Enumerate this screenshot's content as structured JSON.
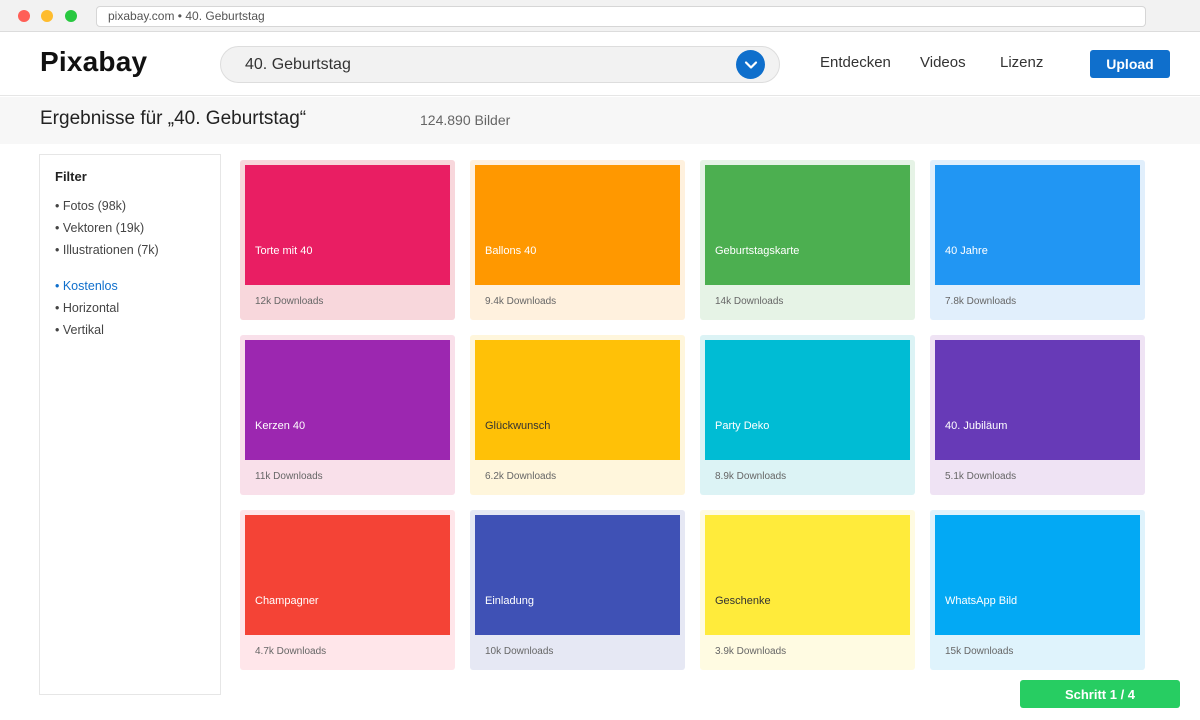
{
  "browser": {
    "address": "pixabay.com • 40. Geburtstag"
  },
  "header": {
    "logo": "Pixabay",
    "search_value": "40. Geburtstag",
    "search_icon": "chevron-down-icon",
    "nav": {
      "discover": "Entdecken",
      "videos": "Videos",
      "license": "Lizenz"
    },
    "upload_label": "Upload",
    "accent_color": "#0f6fcc"
  },
  "results": {
    "title": "Ergebnisse für „40. Geburtstag“",
    "count": "124.890 Bilder"
  },
  "filter": {
    "title": "Filter",
    "items": [
      {
        "label": "• Fotos (98k)",
        "active": false
      },
      {
        "label": "• Vektoren (19k)",
        "active": false
      },
      {
        "label": "• Illustrationen (7k)",
        "active": false
      },
      {
        "label": "• Kostenlos",
        "active": true
      },
      {
        "label": "• Horizontal",
        "active": false
      },
      {
        "label": "• Vertikal",
        "active": false
      }
    ]
  },
  "cards": [
    {
      "label": "Torte mit 40",
      "downloads": "12k Downloads",
      "color": "#e91e63",
      "bg": "#f8d7dc"
    },
    {
      "label": "Ballons 40",
      "downloads": "9.4k Downloads",
      "color": "#ff9800",
      "bg": "#fff1de"
    },
    {
      "label": "Geburtstagskarte",
      "downloads": "14k Downloads",
      "color": "#4caf50",
      "bg": "#e6f3e6"
    },
    {
      "label": "40 Jahre",
      "downloads": "7.8k Downloads",
      "color": "#2196f3",
      "bg": "#e1effc"
    },
    {
      "label": "Kerzen 40",
      "downloads": "11k Downloads",
      "color": "#9c27b0",
      "bg": "#f9e0ea"
    },
    {
      "label": "Glückwunsch",
      "downloads": "6.2k Downloads",
      "color": "#ffc107",
      "bg": "#fff6dc"
    },
    {
      "label": "Party Deko",
      "downloads": "8.9k Downloads",
      "color": "#00bcd4",
      "bg": "#dcf3f5"
    },
    {
      "label": "40. Jubiläum",
      "downloads": "5.1k Downloads",
      "color": "#673ab7",
      "bg": "#efe3f4"
    },
    {
      "label": "Champagner",
      "downloads": "4.7k Downloads",
      "color": "#f44336",
      "bg": "#ffe6ea"
    },
    {
      "label": "Einladung",
      "downloads": "10k Downloads",
      "color": "#3f51b5",
      "bg": "#e6e8f4"
    },
    {
      "label": "Geschenke",
      "downloads": "3.9k Downloads",
      "color": "#ffeb3b",
      "bg": "#fffbe2"
    },
    {
      "label": "WhatsApp Bild",
      "downloads": "15k Downloads",
      "color": "#03a9f4",
      "bg": "#dff3fc"
    }
  ],
  "step_badge": "Schritt 1 / 4",
  "step_color": "#27cd62"
}
